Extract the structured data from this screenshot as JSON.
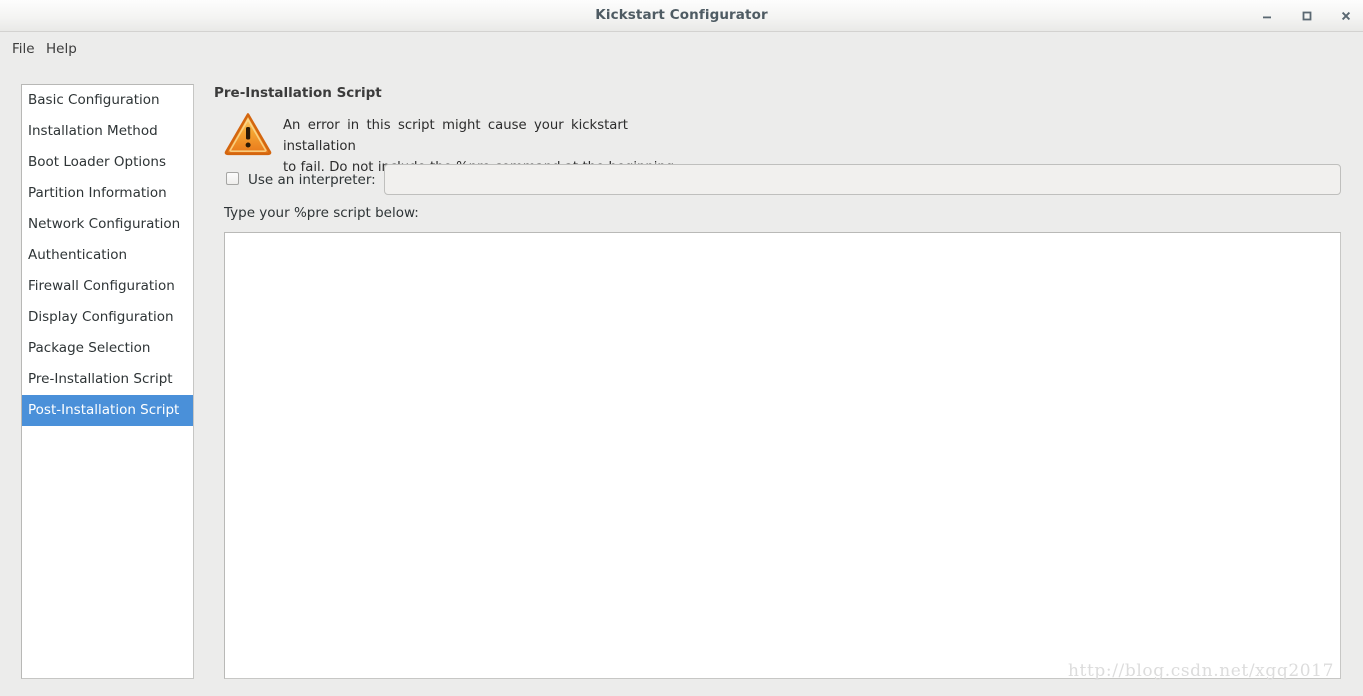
{
  "window": {
    "title": "Kickstart Configurator",
    "controls": [
      {
        "name": "minimize",
        "glyph": "minimize-icon"
      },
      {
        "name": "maximize",
        "glyph": "maximize-icon"
      },
      {
        "name": "close",
        "glyph": "close-icon"
      }
    ]
  },
  "menubar": {
    "items": [
      {
        "label": "File"
      },
      {
        "label": "Help"
      }
    ]
  },
  "sidebar": {
    "selected_index": 10,
    "items": [
      {
        "label": "Basic Configuration"
      },
      {
        "label": "Installation Method"
      },
      {
        "label": "Boot Loader Options"
      },
      {
        "label": "Partition Information"
      },
      {
        "label": "Network Configuration"
      },
      {
        "label": "Authentication"
      },
      {
        "label": "Firewall Configuration"
      },
      {
        "label": "Display Configuration"
      },
      {
        "label": "Package Selection"
      },
      {
        "label": "Pre-Installation Script"
      },
      {
        "label": "Post-Installation Script"
      }
    ]
  },
  "main": {
    "pane_title": "Pre-Installation Script",
    "warning": {
      "icon": "warning-triangle-icon",
      "line1": "An error in this script might cause your kickstart installation",
      "line2": "to fail. Do not include the %pre command at the beginning."
    },
    "interpreter": {
      "checkbox_label": "Use an interpreter:",
      "checked": false,
      "entry_value": "",
      "entry_placeholder": "",
      "entry_enabled": false
    },
    "script": {
      "label": "Type your %pre script below:",
      "value": ""
    }
  },
  "watermark": {
    "text": "http://blog.csdn.net/xgq2017"
  },
  "colors": {
    "selection": "#4a90d9",
    "window_background": "#ececeb",
    "titlebar_text": "#4e5b63",
    "warning_orange": "#f0861f",
    "field_background": "#ffffff",
    "disabled_field_background": "#f1f0ee"
  }
}
